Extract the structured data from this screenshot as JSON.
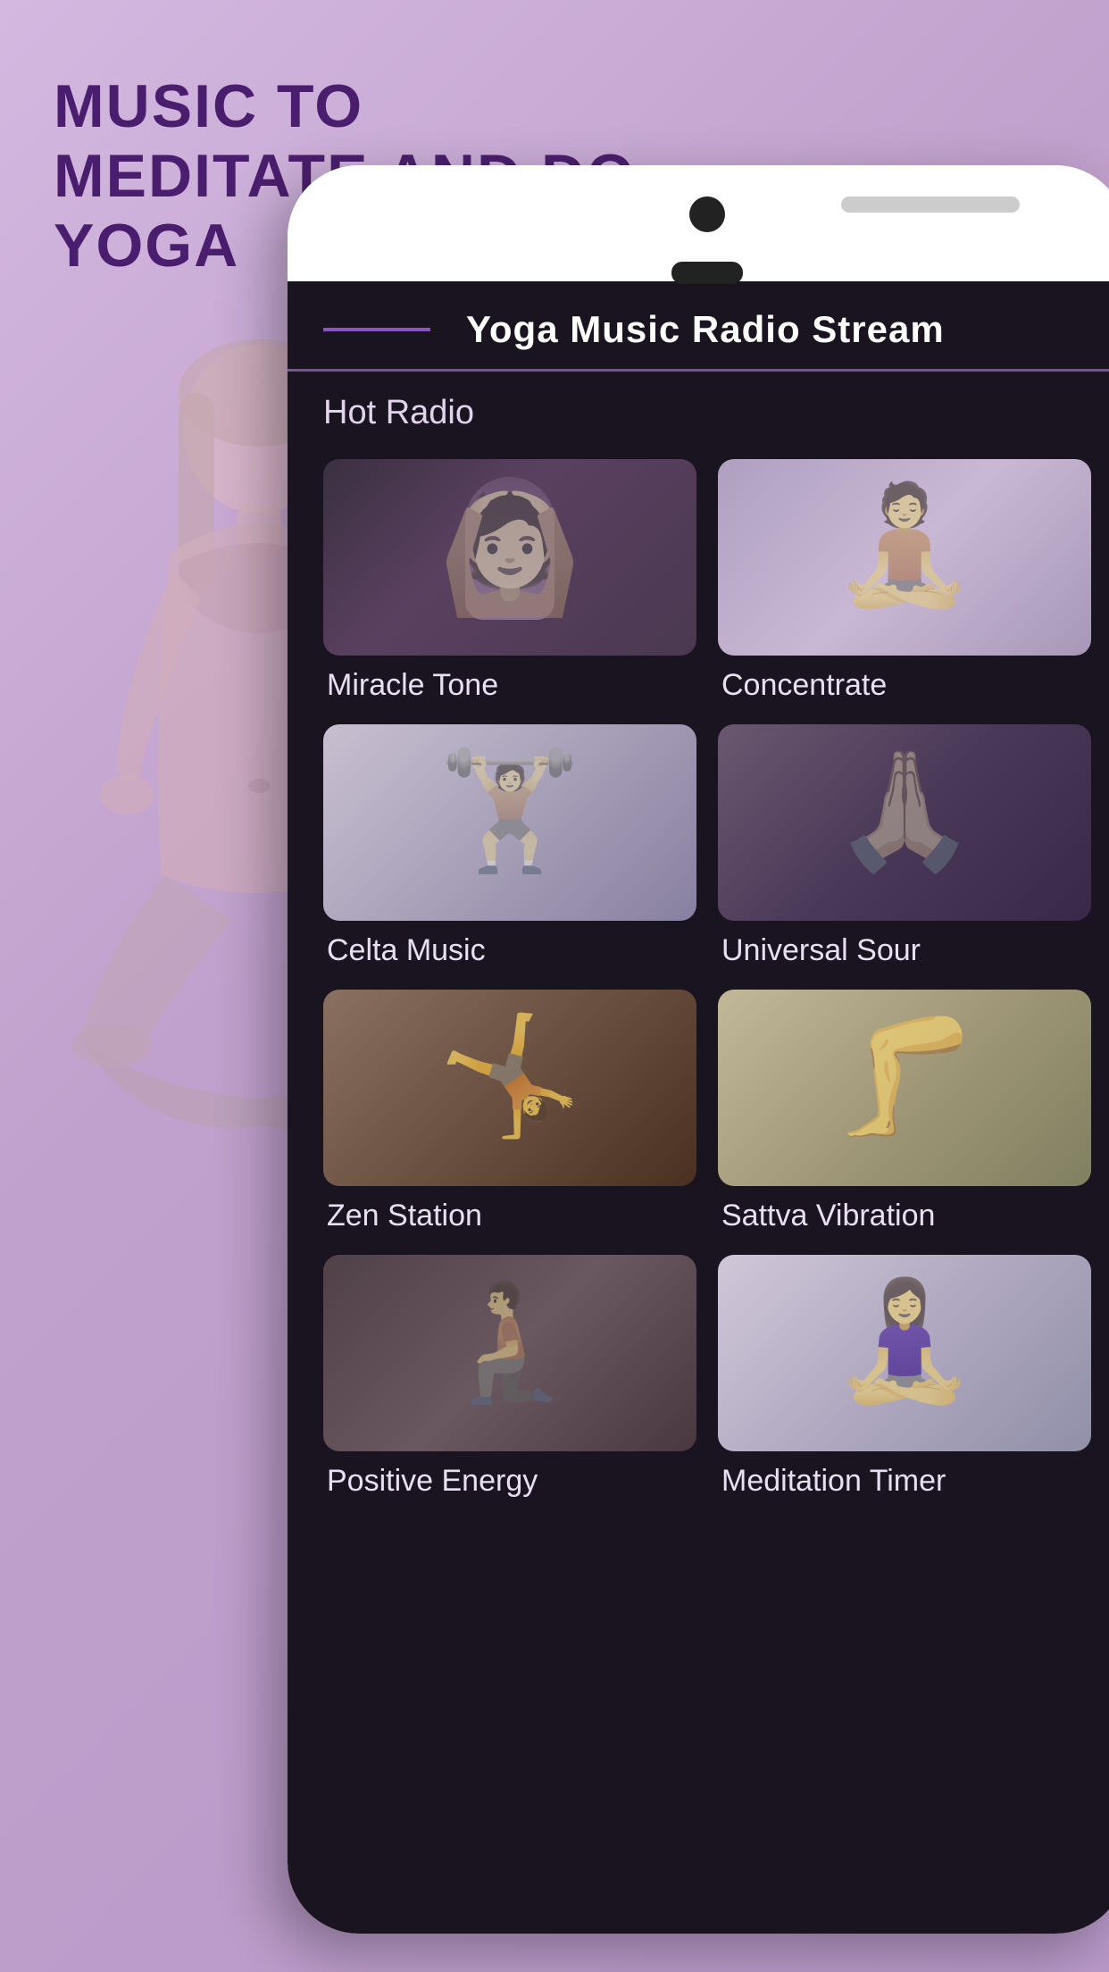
{
  "background_color": "#c9a8d4",
  "page_title": "Music to Meditate and Do Yoga",
  "phone": {
    "app_title": "Yoga Music Radio Stream",
    "header_line_color": "#8855bb",
    "section_label": "Hot Radio",
    "radio_cards": [
      {
        "id": "miracle-tone",
        "name": "Miracle Tone",
        "thumb_class": "thumb-miracle-tone"
      },
      {
        "id": "concentrate",
        "name": "Concentrate",
        "thumb_class": "thumb-concentrate"
      },
      {
        "id": "celta-music",
        "name": "Celta Music",
        "thumb_class": "thumb-celta-music"
      },
      {
        "id": "universal-sour",
        "name": "Universal Sour",
        "thumb_class": "thumb-universal-sour"
      },
      {
        "id": "zen-station",
        "name": "Zen Station",
        "thumb_class": "thumb-zen-station"
      },
      {
        "id": "sattva-vibration",
        "name": "Sattva Vibration",
        "thumb_class": "thumb-sattva-vibration"
      },
      {
        "id": "positive-energy",
        "name": "Positive Energy",
        "thumb_class": "thumb-positive-energy"
      },
      {
        "id": "meditation-timer",
        "name": "Meditation Timer",
        "thumb_class": "thumb-meditation-timer"
      }
    ]
  }
}
